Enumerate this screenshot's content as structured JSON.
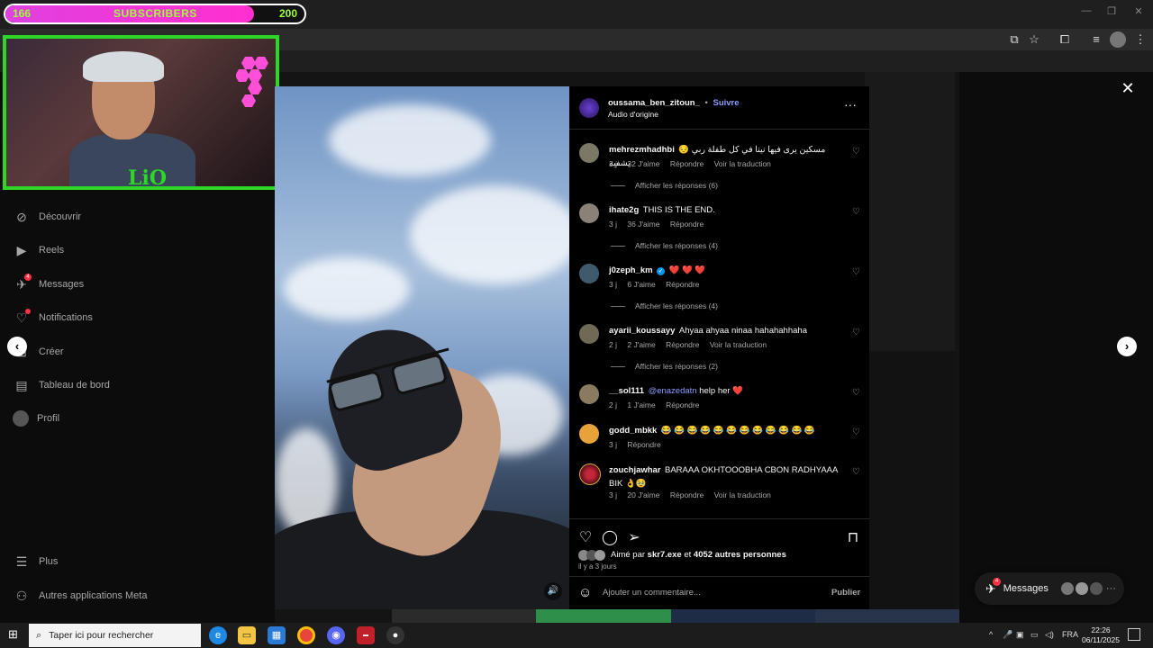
{
  "overlay": {
    "sub_current": "166",
    "sub_label": "SUBSCRIBERS",
    "sub_goal": "200",
    "sub_progress": 0.83,
    "logo_text": "LiO"
  },
  "sidebar": {
    "items": [
      {
        "label": "Découvrir",
        "icon": "compass-icon"
      },
      {
        "label": "Reels",
        "icon": "reels-icon"
      },
      {
        "label": "Messages",
        "icon": "messenger-icon",
        "badge": "4"
      },
      {
        "label": "Notifications",
        "icon": "heart-icon"
      },
      {
        "label": "Créer",
        "icon": "plus-square-icon"
      },
      {
        "label": "Tableau de bord",
        "icon": "dashboard-icon"
      },
      {
        "label": "Profil",
        "icon": "profile-avatar"
      }
    ],
    "bottom": [
      {
        "label": "Plus",
        "icon": "hamburger-icon"
      },
      {
        "label": "Autres applications Meta",
        "icon": "meta-apps-icon"
      }
    ]
  },
  "post": {
    "author": "oussama_ben_zitoun_",
    "follow": "Suivre",
    "audio": "Audio d'origine",
    "likes_text_prefix": "Aimé par ",
    "likes_user": "skr7.exe",
    "likes_mid": " et ",
    "likes_count": "4052 autres personnes",
    "time_ago": "il y a 3 jours",
    "comment_placeholder": "Ajouter un commentaire...",
    "publish": "Publier"
  },
  "comments": [
    {
      "user": "mehrezmhadhbi",
      "text": "😔 مسكين يرى فيها نينا في كل طفلة ربي يشفيه",
      "age": "3 j",
      "likes": "32 J'aime",
      "reply": "Répondre",
      "translate": "Voir la traduction",
      "replies": "Afficher les réponses (6)"
    },
    {
      "user": "ihate2g",
      "text": "THIS IS THE END.",
      "age": "3 j",
      "likes": "36 J'aime",
      "reply": "Répondre",
      "translate": "",
      "replies": "Afficher les réponses (4)"
    },
    {
      "user": "j0zeph_km",
      "text": "❤️ ❤️ ❤️",
      "age": "3 j",
      "likes": "6 J'aime",
      "reply": "Répondre",
      "translate": "",
      "replies": "Afficher les réponses (4)",
      "verified": true
    },
    {
      "user": "ayarii_koussayy",
      "text": "Ahyaa ahyaa ninaa hahahahhaha",
      "age": "2 j",
      "likes": "2 J'aime",
      "reply": "Répondre",
      "translate": "Voir la traduction",
      "replies": "Afficher les réponses (2)"
    },
    {
      "user": "__sol111",
      "mention": "@enazedatn",
      "text": " help her ❤️",
      "age": "2 j",
      "likes": "1 J'aime",
      "reply": "Répondre",
      "translate": "",
      "replies": ""
    },
    {
      "user": "godd_mbkk",
      "text": "😂 😂 😂 😂 😂 😂 😂 😂 😂 😂 😂 😂",
      "age": "3 j",
      "likes": "",
      "reply": "Répondre",
      "translate": "",
      "replies": ""
    },
    {
      "user": "zouchjawhar",
      "text": "BARAAA OKHTOOOBHA CBON RADHYAAA BIK 👌🥹",
      "age": "3 j",
      "likes": "20 J'aime",
      "reply": "Répondre",
      "translate": "Voir la traduction",
      "replies": ""
    }
  ],
  "messages_pill": {
    "label": "Messages",
    "badge": "4"
  },
  "taskbar": {
    "search_placeholder": "Taper ici pour rechercher",
    "lang": "FRA",
    "time": "22:26",
    "date": "06/11/2025"
  },
  "colors": {
    "accent": "#0095f6",
    "follow": "#8c9bff",
    "green_frame": "#2dd627",
    "pink_bar": "#ff2fd0",
    "like_red": "#ff3040"
  }
}
